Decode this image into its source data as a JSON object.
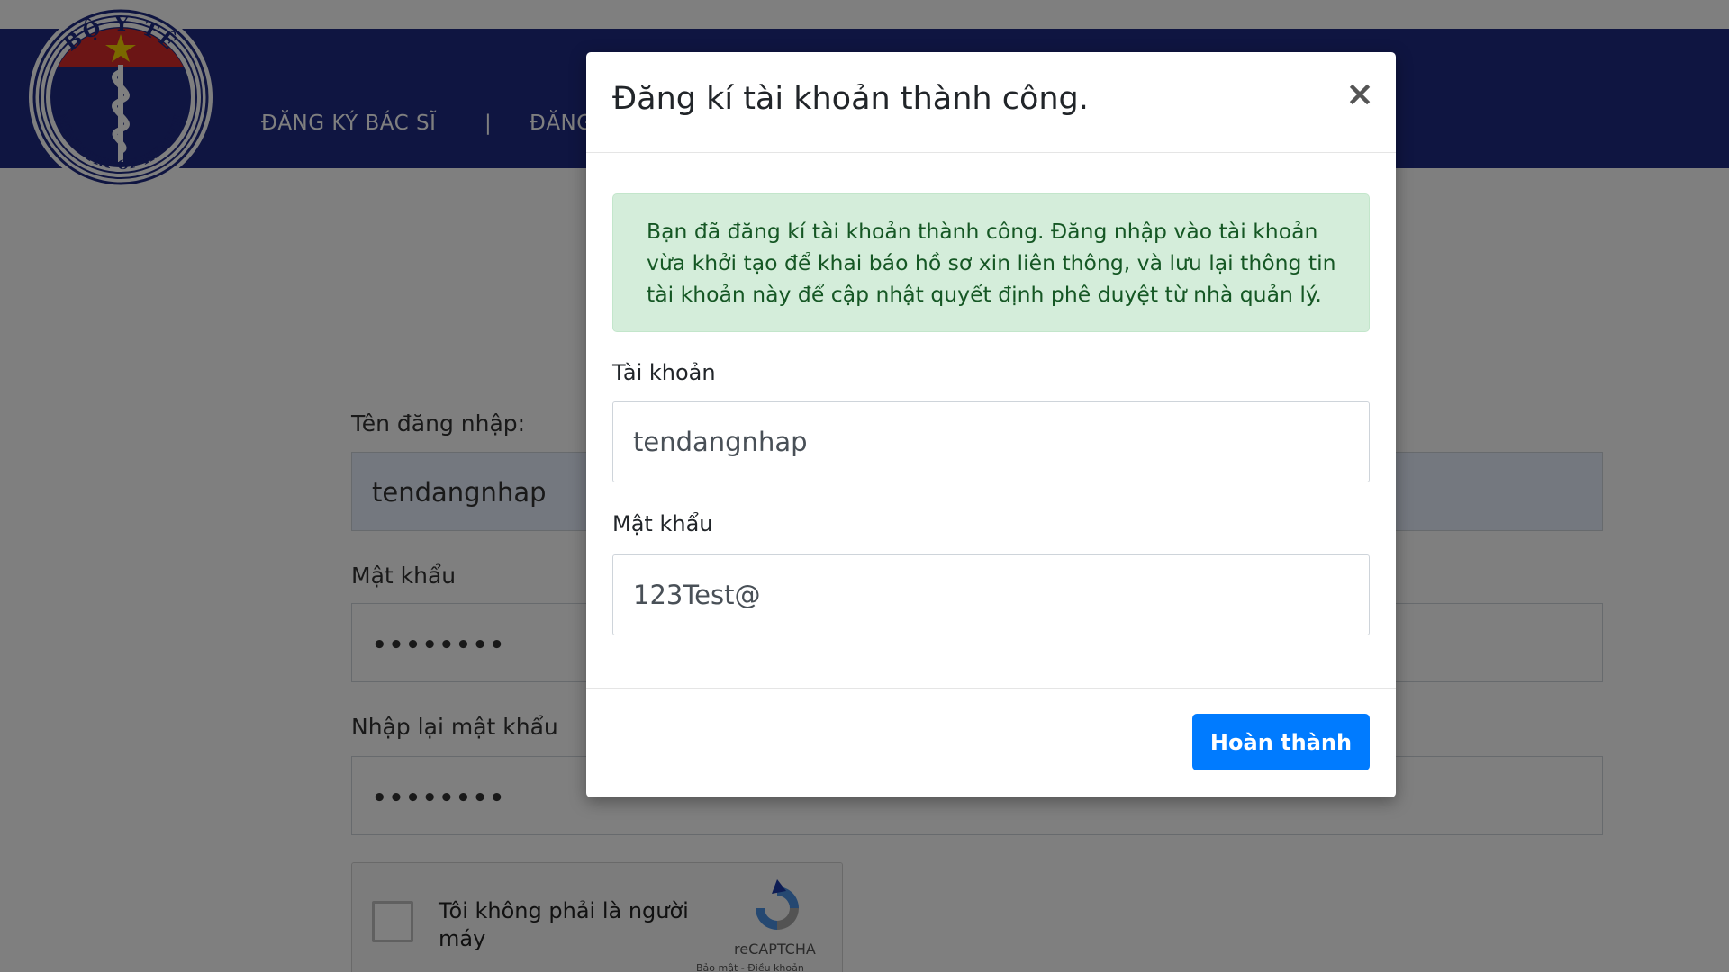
{
  "header": {
    "logo_top_text": "BỘ Y TẾ",
    "logo_bottom_text": "MINISTRY OF HEALTH",
    "nav_doctor_register": "ĐĂNG KÝ BÁC SĨ",
    "nav_separator": "|",
    "nav_second_partial": "ĐĂNG"
  },
  "form": {
    "username_label": "Tên đăng nhập:",
    "username_value": "tendangnhap",
    "password_label": "Mật khẩu",
    "password_value": "••••••••",
    "confirm_label": "Nhập lại mật khẩu",
    "confirm_value": "••••••••",
    "captcha_text": "Tôi không phải là người máy",
    "captcha_brand": "reCAPTCHA",
    "captcha_terms": "Bảo mật - Điều khoản"
  },
  "modal": {
    "title": "Đăng kí tài khoản thành công.",
    "close_symbol": "×",
    "alert_text": "Bạn đã đăng kí tài khoản thành công. Đăng nhập vào tài khoản vừa khởi tạo để khai báo hồ sơ xin liên thông, và lưu lại thông tin tài khoản này để cập nhật quyết định phê duyệt từ nhà quản lý.",
    "account_label": "Tài khoản",
    "account_value": "tendangnhap",
    "password_label": "Mật khẩu",
    "password_value": "123Test@",
    "done_button": "Hoàn thành"
  },
  "colors": {
    "navbar": "#1f2a82",
    "alert_bg": "#d4edda",
    "alert_text": "#155724",
    "primary_button": "#007bff"
  },
  "icons": {
    "logo": "ministry-of-health-emblem-icon",
    "close": "close-icon",
    "captcha": "recaptcha-logo-icon"
  }
}
